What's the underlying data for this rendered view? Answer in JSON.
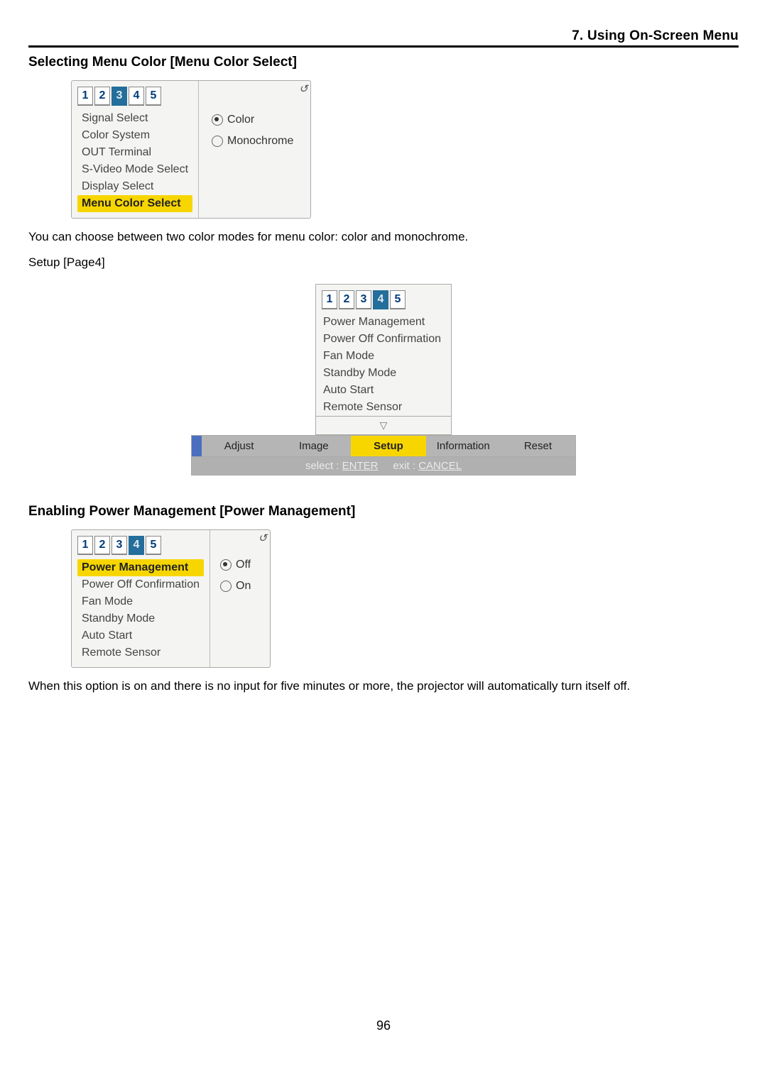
{
  "page": {
    "chapter": "7. Using On-Screen Menu",
    "number": "96"
  },
  "section1": {
    "heading": "Selecting Menu Color [Menu Color Select]",
    "note": "You can choose between two color modes for menu color: color and monochrome.",
    "page_label": "Setup [Page4]"
  },
  "fig1": {
    "tabs": [
      "1",
      "2",
      "3",
      "4",
      "5"
    ],
    "active": "3",
    "items": [
      "Signal Select",
      "Color System",
      "OUT Terminal",
      "S-Video Mode Select",
      "Display Select",
      "Menu Color Select"
    ],
    "highlight": "Menu Color Select",
    "radio_options": [
      "Color",
      "Monochrome"
    ],
    "radio_selected": "Color",
    "corner": "↺"
  },
  "fig2": {
    "tabs": [
      "1",
      "2",
      "3",
      "4",
      "5"
    ],
    "active": "4",
    "items": [
      "Power Management",
      "Power Off Confirmation",
      "Fan Mode",
      "Standby Mode",
      "Auto Start",
      "Remote Sensor"
    ],
    "arrow": "▽",
    "menubar": {
      "items": [
        "Adjust",
        "Image",
        "Setup",
        "Information",
        "Reset"
      ],
      "highlight": "Setup",
      "hint_select": "select : ",
      "hint_select_key": "ENTER",
      "hint_exit": "exit : ",
      "hint_exit_key": "CANCEL"
    }
  },
  "section2": {
    "heading": "Enabling Power Management [Power Management]",
    "note": "When this option is on and there is no input for five minutes or more, the projector will automatically turn itself off."
  },
  "fig3": {
    "tabs": [
      "1",
      "2",
      "3",
      "4",
      "5"
    ],
    "active": "4",
    "items": [
      "Power Management",
      "Power Off Confirmation",
      "Fan Mode",
      "Standby Mode",
      "Auto Start",
      "Remote Sensor"
    ],
    "highlight": "Power Management",
    "radio_options": [
      "Off",
      "On"
    ],
    "radio_selected": "Off",
    "corner": "↺"
  }
}
